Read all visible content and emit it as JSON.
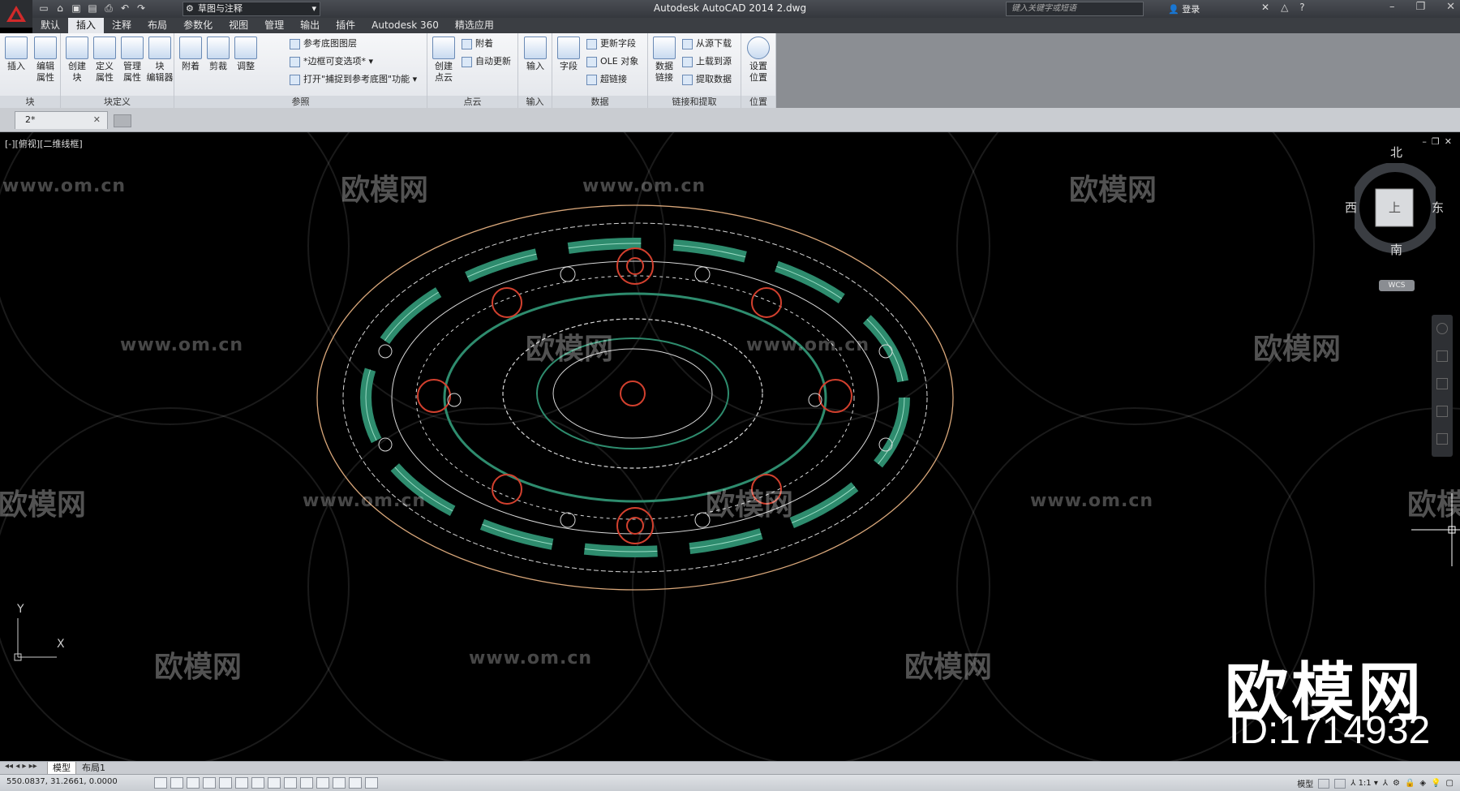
{
  "titlebar": {
    "app_title": "Autodesk AutoCAD 2014    2.dwg",
    "workspace": "草图与注释",
    "search_placeholder": "键入关键字或短语",
    "login": "登录"
  },
  "menu_tabs": [
    "默认",
    "插入",
    "注释",
    "布局",
    "参数化",
    "视图",
    "管理",
    "输出",
    "插件",
    "Autodesk 360",
    "精选应用"
  ],
  "active_tab": "插入",
  "ribbon": {
    "block": {
      "title": "块",
      "insert": "插入",
      "edit_attr": "编辑\n属性"
    },
    "block_def": {
      "title": "块定义",
      "create": "创建\n块",
      "define_attr": "定义\n属性",
      "manage_attr": "管理\n属性",
      "block_editor": "块\n编辑器"
    },
    "reference": {
      "title": "参照",
      "attach": "附着",
      "clip": "剪裁",
      "adjust": "调整",
      "underlay_layers": "参考底图图层",
      "frame": "*边框可变选项*",
      "snap": "打开\"捕捉到参考底图\"功能"
    },
    "point_cloud": {
      "title": "点云",
      "create": "创建\n点云",
      "attach": "附着",
      "auto_update": "自动更新"
    },
    "import": {
      "title": "输入",
      "import": "输入"
    },
    "data": {
      "title": "数据",
      "field": "字段",
      "update_fields": "更新字段",
      "ole": "OLE 对象",
      "hyperlink": "超链接"
    },
    "link_extract": {
      "title": "链接和提取",
      "data_link": "数据\n链接",
      "download": "从源下载",
      "upload": "上载到源",
      "extract": "提取数据"
    },
    "location": {
      "title": "位置",
      "set_location": "设置\n位置"
    }
  },
  "doc_tab": "2*",
  "viewport": {
    "label": "[-][俯视][二维线框]",
    "compass": {
      "north": "北",
      "south": "南",
      "west": "西",
      "east": "东",
      "face": "上"
    },
    "wcs": "WCS",
    "ucs_y": "Y",
    "ucs_x": "X"
  },
  "watermark": {
    "url": "www.om.cn",
    "brand": "欧模网",
    "brand_large": "欧模网",
    "id": "ID:1714932"
  },
  "layout_tabs": [
    "模型",
    "布局1"
  ],
  "status": {
    "coords": "550.0837, 31.2661, 0.0000",
    "model": "模型",
    "scale": "1:1"
  },
  "colors": {
    "ellipse_outline": "#d9a77a",
    "ornament_white": "#d8d8d8",
    "ornament_red": "#d2402e",
    "ornament_green": "#2e8c6e",
    "background": "#000000"
  }
}
